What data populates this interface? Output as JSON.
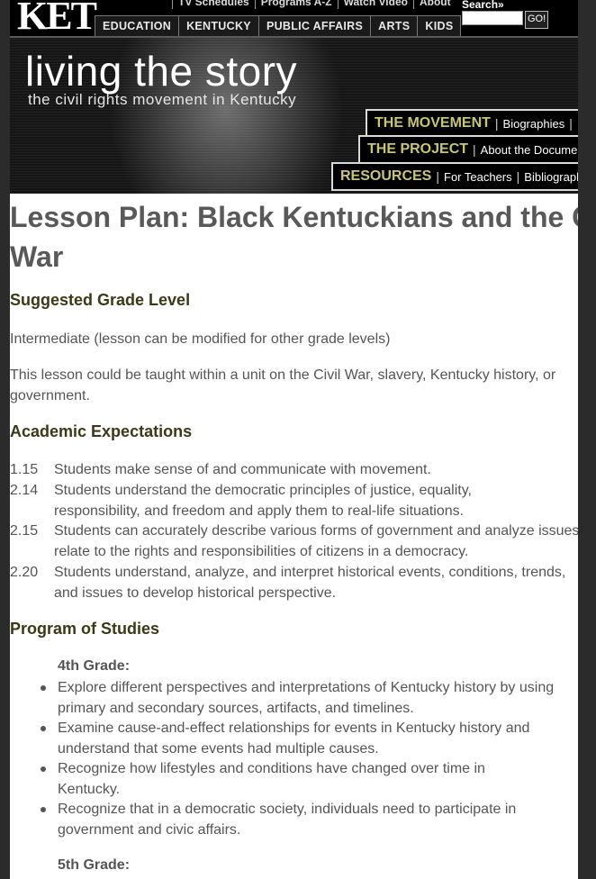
{
  "header": {
    "logo": "KET",
    "top_nav": [
      "TV Schedules",
      "Programs A-Z",
      "Watch Video",
      "About"
    ],
    "main_nav": [
      "EDUCATION",
      "KENTUCKY",
      "PUBLIC AFFAIRS",
      "ARTS",
      "KIDS"
    ],
    "search_label": "Search»",
    "search_value": "",
    "search_button": "GO!"
  },
  "banner": {
    "title": "living the story",
    "subtitle": "the civil rights movement in Kentucky",
    "sections": [
      {
        "heading": "THE MOVEMENT",
        "link": "Biographies"
      },
      {
        "heading": "THE PROJECT",
        "link": "About the Documentary"
      },
      {
        "heading": "RESOURCES",
        "link": "For Teachers",
        "link2": "Bibliography"
      }
    ]
  },
  "content": {
    "title": "Lesson Plan: Black Kentuckians and the Civil War",
    "grade_heading": "Suggested Grade Level",
    "grade_text": "Intermediate (lesson can be modified for other grade levels)",
    "unit_text": "This lesson could be taught within a unit on the Civil War, slavery, Kentucky history, or government.",
    "ae_heading": "Academic Expectations",
    "academic_expectations": [
      {
        "num": "1.15",
        "text": "Students make sense of and communicate with movement."
      },
      {
        "num": "2.14",
        "text": "Students understand the democratic principles of justice, equality, responsibility, and freedom and apply them to real-life situations."
      },
      {
        "num": "2.15",
        "text": "Students can accurately describe various forms of government and analyze issues that relate to the rights and responsibilities of citizens in a democracy."
      },
      {
        "num": "2.20",
        "text": "Students understand, analyze, and interpret historical events, conditions, trends, and issues to develop historical perspective."
      }
    ],
    "pos_heading": "Program of Studies",
    "grade4_label": "4th Grade:",
    "grade4_items": [
      "Explore different perspectives and interpretations of Kentucky history by using primary and secondary sources, artifacts, and timelines.",
      "Examine cause-and-effect relationships for events in Kentucky history and understand that some events had multiple causes.",
      "Recognize how lifestyles and conditions have changed over time in Kentucky.",
      "Recognize that in a democratic society, individuals need to participate in government and civic affairs."
    ],
    "grade5_label": "5th Grade:"
  }
}
